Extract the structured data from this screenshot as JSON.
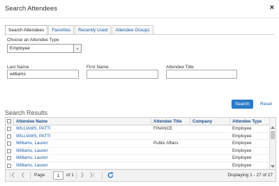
{
  "dialog": {
    "title": "Search Attendees",
    "close_label": "×"
  },
  "tabs": [
    {
      "label": "Search Attendees",
      "active": true
    },
    {
      "label": "Favorites",
      "active": false
    },
    {
      "label": "Recently Used",
      "active": false
    },
    {
      "label": "Attendee Groups",
      "active": false
    }
  ],
  "form": {
    "type_label": "Choose an Attendee Type",
    "type_value": "Employee",
    "last_name_label": "Last Name",
    "last_name_value": "williams",
    "first_name_label": "First Name",
    "first_name_value": "",
    "title_label": "Attendee Title",
    "title_value": "",
    "search_label": "Search",
    "reset_label": "Reset"
  },
  "results": {
    "title": "Search Results",
    "columns": [
      "Attendee Name",
      "Attendee Title",
      "Company",
      "Attendee Type"
    ],
    "rows": [
      {
        "name": "WILLIAMS, PATTI",
        "title": "FINANCE",
        "company": "",
        "type": "Employee"
      },
      {
        "name": "WILLIAMS, PATTI",
        "title": "",
        "company": "",
        "type": "Employee"
      },
      {
        "name": "Williams, Lauren",
        "title": "Public Affairs",
        "company": "",
        "type": "Employee"
      },
      {
        "name": "Williams, Lauren",
        "title": "",
        "company": "",
        "type": "Employee"
      },
      {
        "name": "Williams, Lauren",
        "title": "",
        "company": "",
        "type": "Employee"
      },
      {
        "name": "Williams, Lauren",
        "title": "",
        "company": "",
        "type": "Employee"
      }
    ]
  },
  "pager": {
    "page_label": "Page",
    "page_value": "1",
    "of_label": "of 1",
    "display_text": "Displaying 1 - 27 of 27"
  },
  "colors": {
    "accent": "#2b7bc8",
    "link": "#1a5da4"
  }
}
